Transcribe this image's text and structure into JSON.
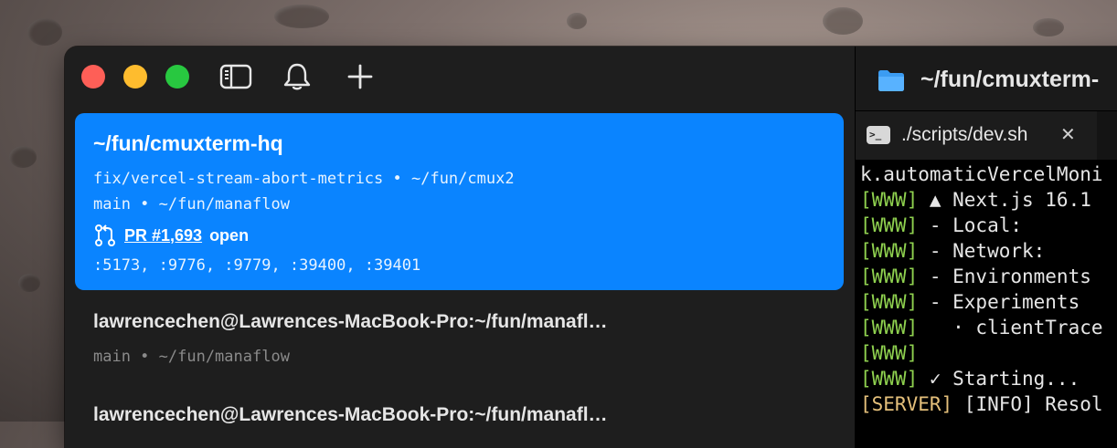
{
  "titlebar": {
    "buttons": [
      "sidebar-toggle",
      "notifications",
      "new-workspace"
    ]
  },
  "sidebar": {
    "active": {
      "title": "~/fun/cmuxterm-hq",
      "branch_line": "fix/vercel-stream-abort-metrics • ~/fun/cmux2",
      "main_line": "main • ~/fun/manaflow",
      "pr_label": "PR #1,693",
      "pr_status": "open",
      "ports": ":5173, :9776, :9779, :39400, :39401"
    },
    "items": [
      {
        "title": "lawrencechen@Lawrences-MacBook-Pro:~/fun/manafl…",
        "sub": "main • ~/fun/manaflow"
      },
      {
        "title": "lawrencechen@Lawrences-MacBook-Pro:~/fun/manafl…"
      }
    ]
  },
  "pane": {
    "title": "~/fun/cmuxterm-",
    "tab_label": "./scripts/dev.sh",
    "tab_icon": ">_",
    "lines": [
      {
        "prefix": "",
        "text": "k.automaticVercelMoni"
      },
      {
        "prefix": "[WWW]",
        "text": " ▲ Next.js 16.1"
      },
      {
        "prefix": "[WWW]",
        "text": " - Local:"
      },
      {
        "prefix": "[WWW]",
        "text": " - Network:"
      },
      {
        "prefix": "[WWW]",
        "text": " - Environments"
      },
      {
        "prefix": "[WWW]",
        "text": " - Experiments"
      },
      {
        "prefix": "[WWW]",
        "text": "   · clientTrace"
      },
      {
        "prefix": "[WWW]",
        "text": ""
      },
      {
        "prefix": "[WWW]",
        "text": " ✓ Starting..."
      },
      {
        "prefix": "[SERVER]",
        "text": " [INFO] Resol"
      }
    ]
  },
  "colors": {
    "accent": "#0a84ff",
    "www_prefix": "#8fd14f",
    "server_prefix": "#e5c07b"
  }
}
